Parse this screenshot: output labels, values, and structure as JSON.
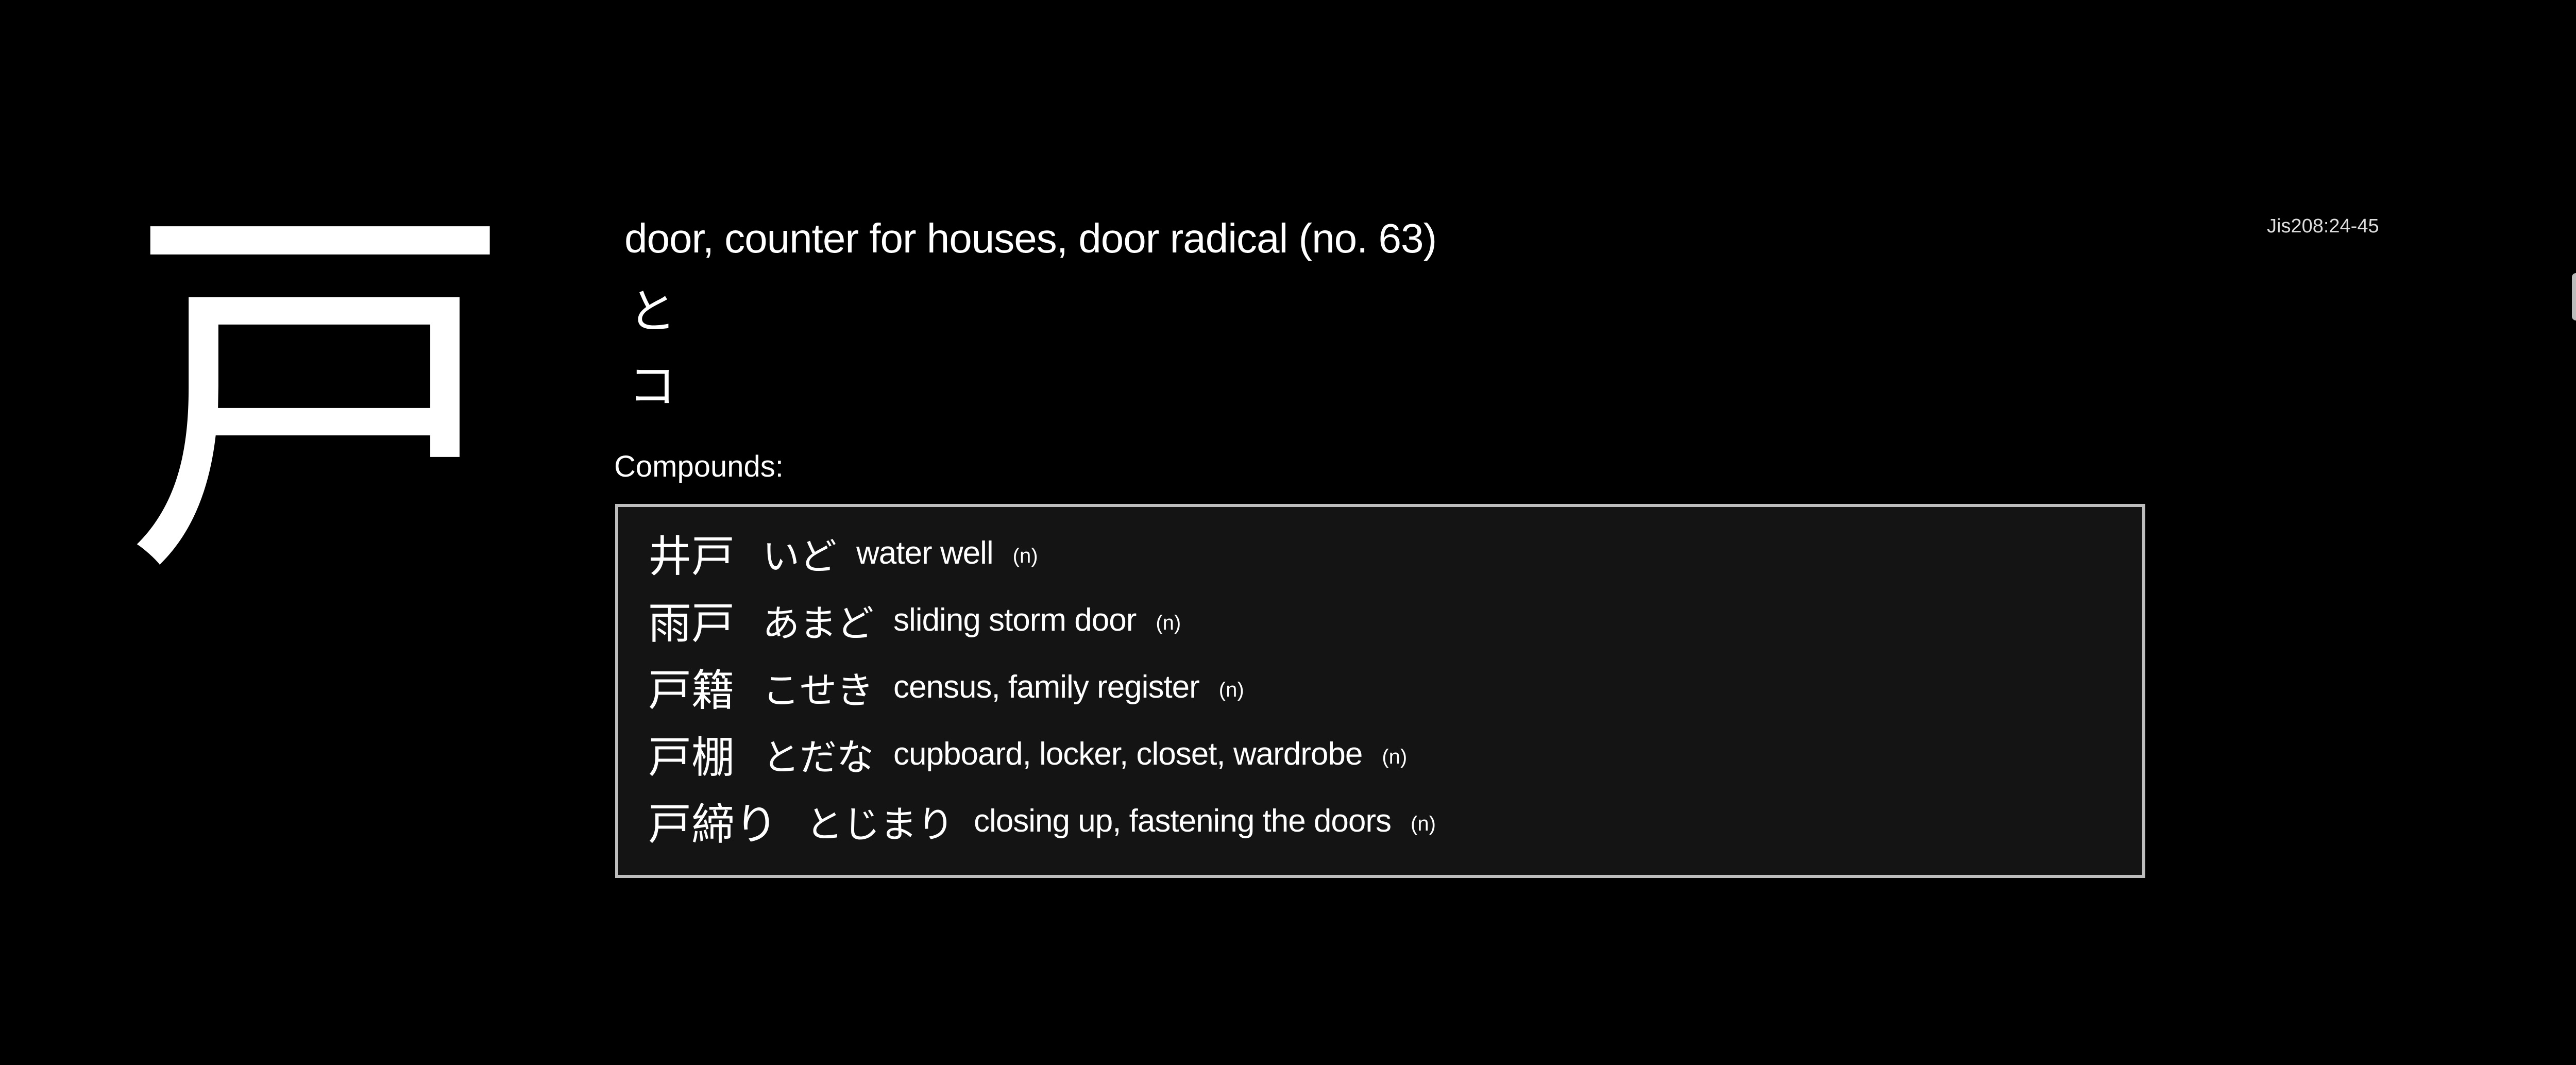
{
  "kanji": {
    "character": "戸",
    "meaning": "door, counter for houses, door radical (no. 63)",
    "kun_reading": "と",
    "on_reading": "コ",
    "jis_code": "Jis208:24-45"
  },
  "compounds": {
    "label": "Compounds:",
    "items": [
      {
        "word": "井戸",
        "reading": "いど",
        "gloss": "water well",
        "pos": "(n)"
      },
      {
        "word": "雨戸",
        "reading": "あまど",
        "gloss": "sliding storm door",
        "pos": "(n)"
      },
      {
        "word": "戸籍",
        "reading": "こせき",
        "gloss": "census, family register",
        "pos": "(n)"
      },
      {
        "word": "戸棚",
        "reading": "とだな",
        "gloss": "cupboard, locker, closet, wardrobe",
        "pos": "(n)"
      },
      {
        "word": "戸締り",
        "reading": "とじまり",
        "gloss": "closing up, fastening the doors",
        "pos": "(n)"
      }
    ]
  }
}
